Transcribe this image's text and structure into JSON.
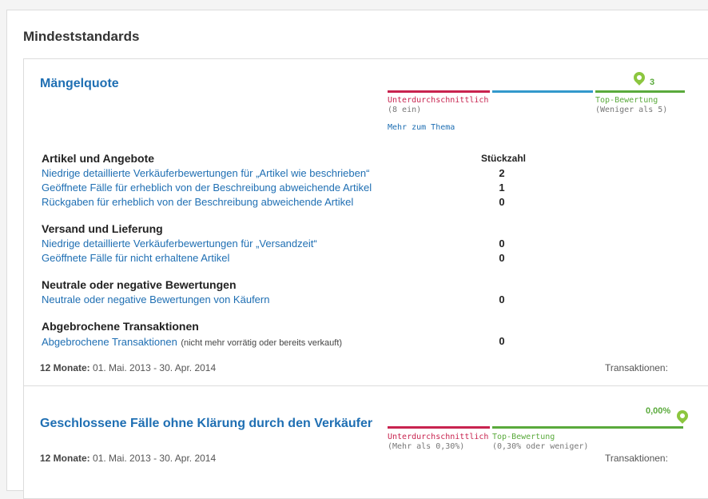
{
  "page": {
    "title": "Mindeststandards"
  },
  "mangelquote": {
    "title": "Mängelquote",
    "rating": {
      "marker_value": "3",
      "low_label": "Unterdurchschnittlich",
      "low_sub": "(8 ein)",
      "top_label": "Top-Bewertung",
      "top_sub": "(Weniger als 5)",
      "more_link": "Mehr zum Thema",
      "colors": {
        "low": "#c8234f",
        "mid": "#3399cc",
        "top": "#5aaa3c"
      }
    },
    "column_header": "Stückzahl",
    "sections": [
      {
        "heading": "Artikel und Angebote",
        "rows": [
          {
            "label": "Niedrige detaillierte Verkäuferbewertungen für „Artikel wie beschrieben“",
            "value": "2"
          },
          {
            "label": "Geöffnete Fälle für erheblich von der Beschreibung abweichende Artikel",
            "value": "1"
          },
          {
            "label": "Rückgaben für erheblich von der Beschreibung abweichende Artikel",
            "value": "0"
          }
        ]
      },
      {
        "heading": "Versand und Lieferung",
        "rows": [
          {
            "label": "Niedrige detaillierte Verkäuferbewertungen für „Versandzeit“",
            "value": "0"
          },
          {
            "label": "Geöffnete Fälle für nicht erhaltene Artikel",
            "value": "0"
          }
        ]
      },
      {
        "heading": "Neutrale oder negative Bewertungen",
        "rows": [
          {
            "label": "Neutrale oder negative Bewertungen von Käufern",
            "value": "0"
          }
        ]
      },
      {
        "heading": "Abgebrochene Transaktionen",
        "rows": [
          {
            "label": "Abgebrochene Transaktionen",
            "note": "(nicht mehr vorrätig oder bereits verkauft)",
            "value": "0"
          }
        ]
      }
    ],
    "footer": {
      "period_label": "12 Monate:",
      "period": "01. Mai. 2013 - 30. Apr. 2014",
      "transactions_label": "Transaktionen:"
    }
  },
  "geschlossene": {
    "title": "Geschlossene Fälle ohne Klärung durch den Verkäufer",
    "rating": {
      "marker_value": "0,00%",
      "low_label": "Unterdurchschnittlich",
      "low_sub": "(Mehr als 0,30%)",
      "top_label": "Top-Bewertung",
      "top_sub": "(0,30% oder weniger)"
    },
    "footer": {
      "period_label": "12 Monate:",
      "period": "01. Mai. 2013 - 30. Apr. 2014",
      "transactions_label": "Transaktionen:"
    }
  }
}
